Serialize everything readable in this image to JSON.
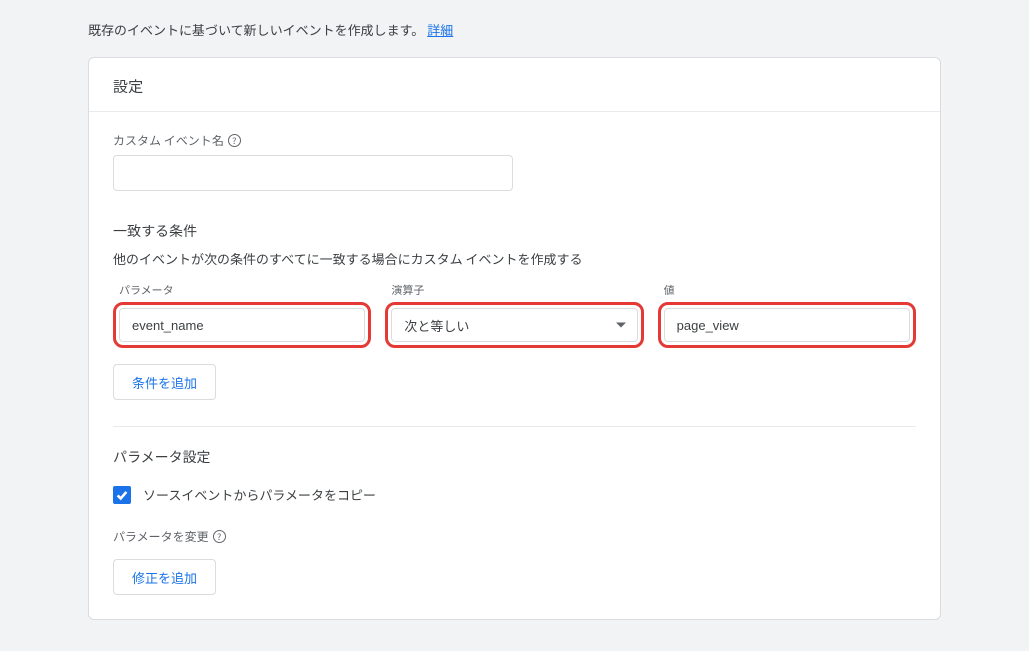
{
  "intro": {
    "text": "既存のイベントに基づいて新しいイベントを作成します。",
    "link_label": "詳細"
  },
  "card": {
    "header": "設定",
    "custom_event": {
      "label": "カスタム イベント名",
      "value": ""
    },
    "conditions": {
      "title": "一致する条件",
      "desc": "他のイベントが次の条件のすべてに一致する場合にカスタム イベントを作成する",
      "labels": {
        "parameter": "パラメータ",
        "operator": "演算子",
        "value": "値"
      },
      "row": {
        "parameter": "event_name",
        "operator": "次と等しい",
        "value": "page_view"
      },
      "add_button": "条件を追加"
    },
    "param_settings": {
      "title": "パラメータ設定",
      "copy_label": "ソースイベントからパラメータをコピー",
      "modify_label": "パラメータを変更",
      "add_fix_button": "修正を追加"
    }
  }
}
